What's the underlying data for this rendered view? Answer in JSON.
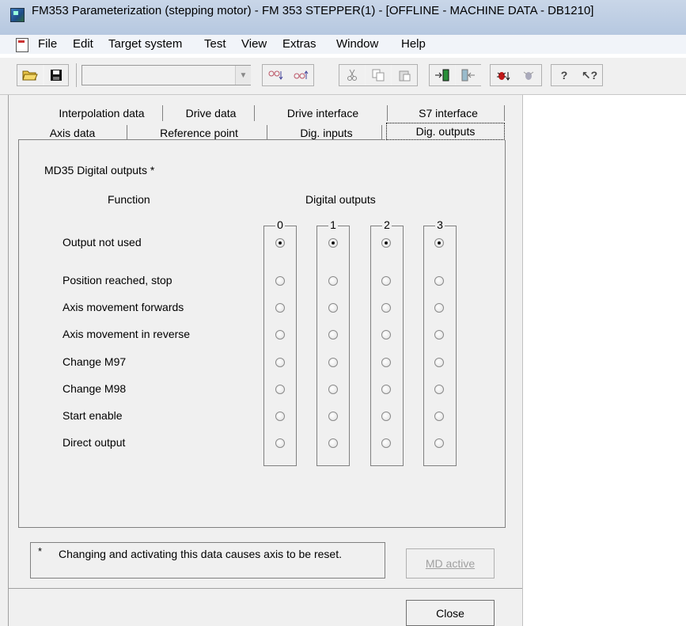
{
  "window": {
    "title": "FM353 Parameterization (stepping motor) - FM 353 STEPPER(1) - [OFFLINE - MACHINE DATA - DB1210]"
  },
  "menu": [
    "File",
    "Edit",
    "Target system",
    "Test",
    "View",
    "Extras",
    "Window",
    "Help"
  ],
  "toolbar": {
    "combo_value": "",
    "buttons": [
      "open-folder-icon",
      "save-icon",
      "find-down-icon",
      "find-up-icon",
      "cut-icon",
      "copy-icon",
      "paste-icon",
      "download-icon",
      "upload-icon",
      "debug-icon",
      "debug-clear-icon",
      "help-icon",
      "context-help-icon"
    ]
  },
  "tabs": {
    "row1": [
      "Interpolation data",
      "Drive data",
      "Drive interface",
      "S7 interface"
    ],
    "row2": [
      "Axis data",
      "Reference point",
      "Dig. inputs",
      "Dig. outputs"
    ],
    "active": "Dig. outputs"
  },
  "panel": {
    "section_title": "MD35 Digital outputs *",
    "function_header": "Function",
    "outputs_header": "Digital outputs",
    "columns": [
      "0",
      "1",
      "2",
      "3"
    ],
    "rows": [
      {
        "label": "Output not used",
        "selected": [
          true,
          true,
          true,
          true
        ]
      },
      {
        "label": "Position reached, stop",
        "selected": [
          false,
          false,
          false,
          false
        ]
      },
      {
        "label": "Axis movement forwards",
        "selected": [
          false,
          false,
          false,
          false
        ]
      },
      {
        "label": "Axis movement in reverse",
        "selected": [
          false,
          false,
          false,
          false
        ]
      },
      {
        "label": "Change M97",
        "selected": [
          false,
          false,
          false,
          false
        ]
      },
      {
        "label": "Change M98",
        "selected": [
          false,
          false,
          false,
          false
        ]
      },
      {
        "label": "Start enable",
        "selected": [
          false,
          false,
          false,
          false
        ]
      },
      {
        "label": "Direct output",
        "selected": [
          false,
          false,
          false,
          false
        ]
      }
    ]
  },
  "note": {
    "asterisk": "*",
    "text": "Changing and activating this data causes axis to be reset."
  },
  "buttons": {
    "md_active": "MD active",
    "close": "Close"
  }
}
